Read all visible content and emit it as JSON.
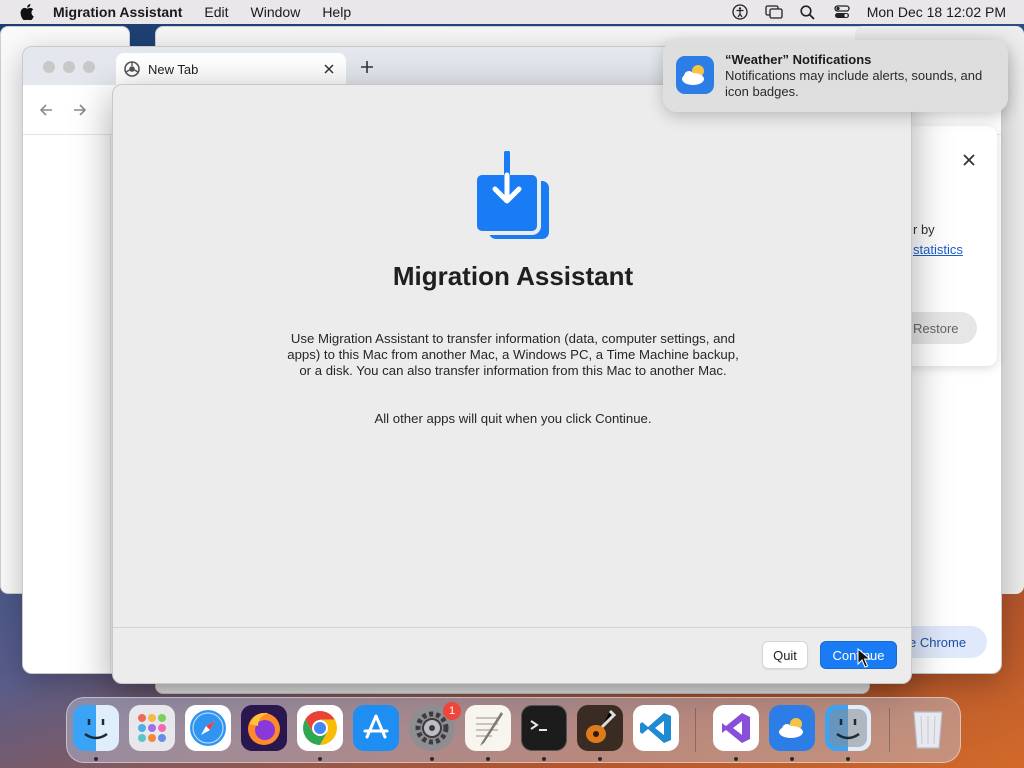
{
  "menubar": {
    "app_name": "Migration Assistant",
    "menus": [
      "Edit",
      "Window",
      "Help"
    ],
    "clock": "Mon Dec 18  12:02 PM",
    "status_icons": [
      "accessibility-icon",
      "screen-mirroring-icon",
      "spotlight-search-icon",
      "control-center-icon"
    ]
  },
  "chrome": {
    "tab_title": "New Tab",
    "card_text": "r by",
    "card_link": "statistics",
    "restore_label": "Restore",
    "pill_label": "e Chrome"
  },
  "migration": {
    "title": "Migration Assistant",
    "description": "Use Migration Assistant to transfer information (data, computer settings, and apps) to this Mac from another Mac, a Windows PC, a Time Machine backup, or a disk. You can also transfer information from this Mac to another Mac.",
    "note": "All other apps will quit when you click Continue.",
    "quit_label": "Quit",
    "continue_label": "Continue",
    "icon_color": "#1a7cf4"
  },
  "notification": {
    "title": "“Weather” Notifications",
    "body": "Notifications may include alerts, sounds, and icon badges."
  },
  "dock": {
    "items": [
      "finder",
      "launchpad",
      "safari",
      "firefox",
      "chrome",
      "app-store",
      "system-settings",
      "textedit",
      "terminal",
      "garageband",
      "vscode",
      "visual-studio",
      "weather",
      "migration-assistant",
      "trash"
    ],
    "settings_badge": "1"
  }
}
